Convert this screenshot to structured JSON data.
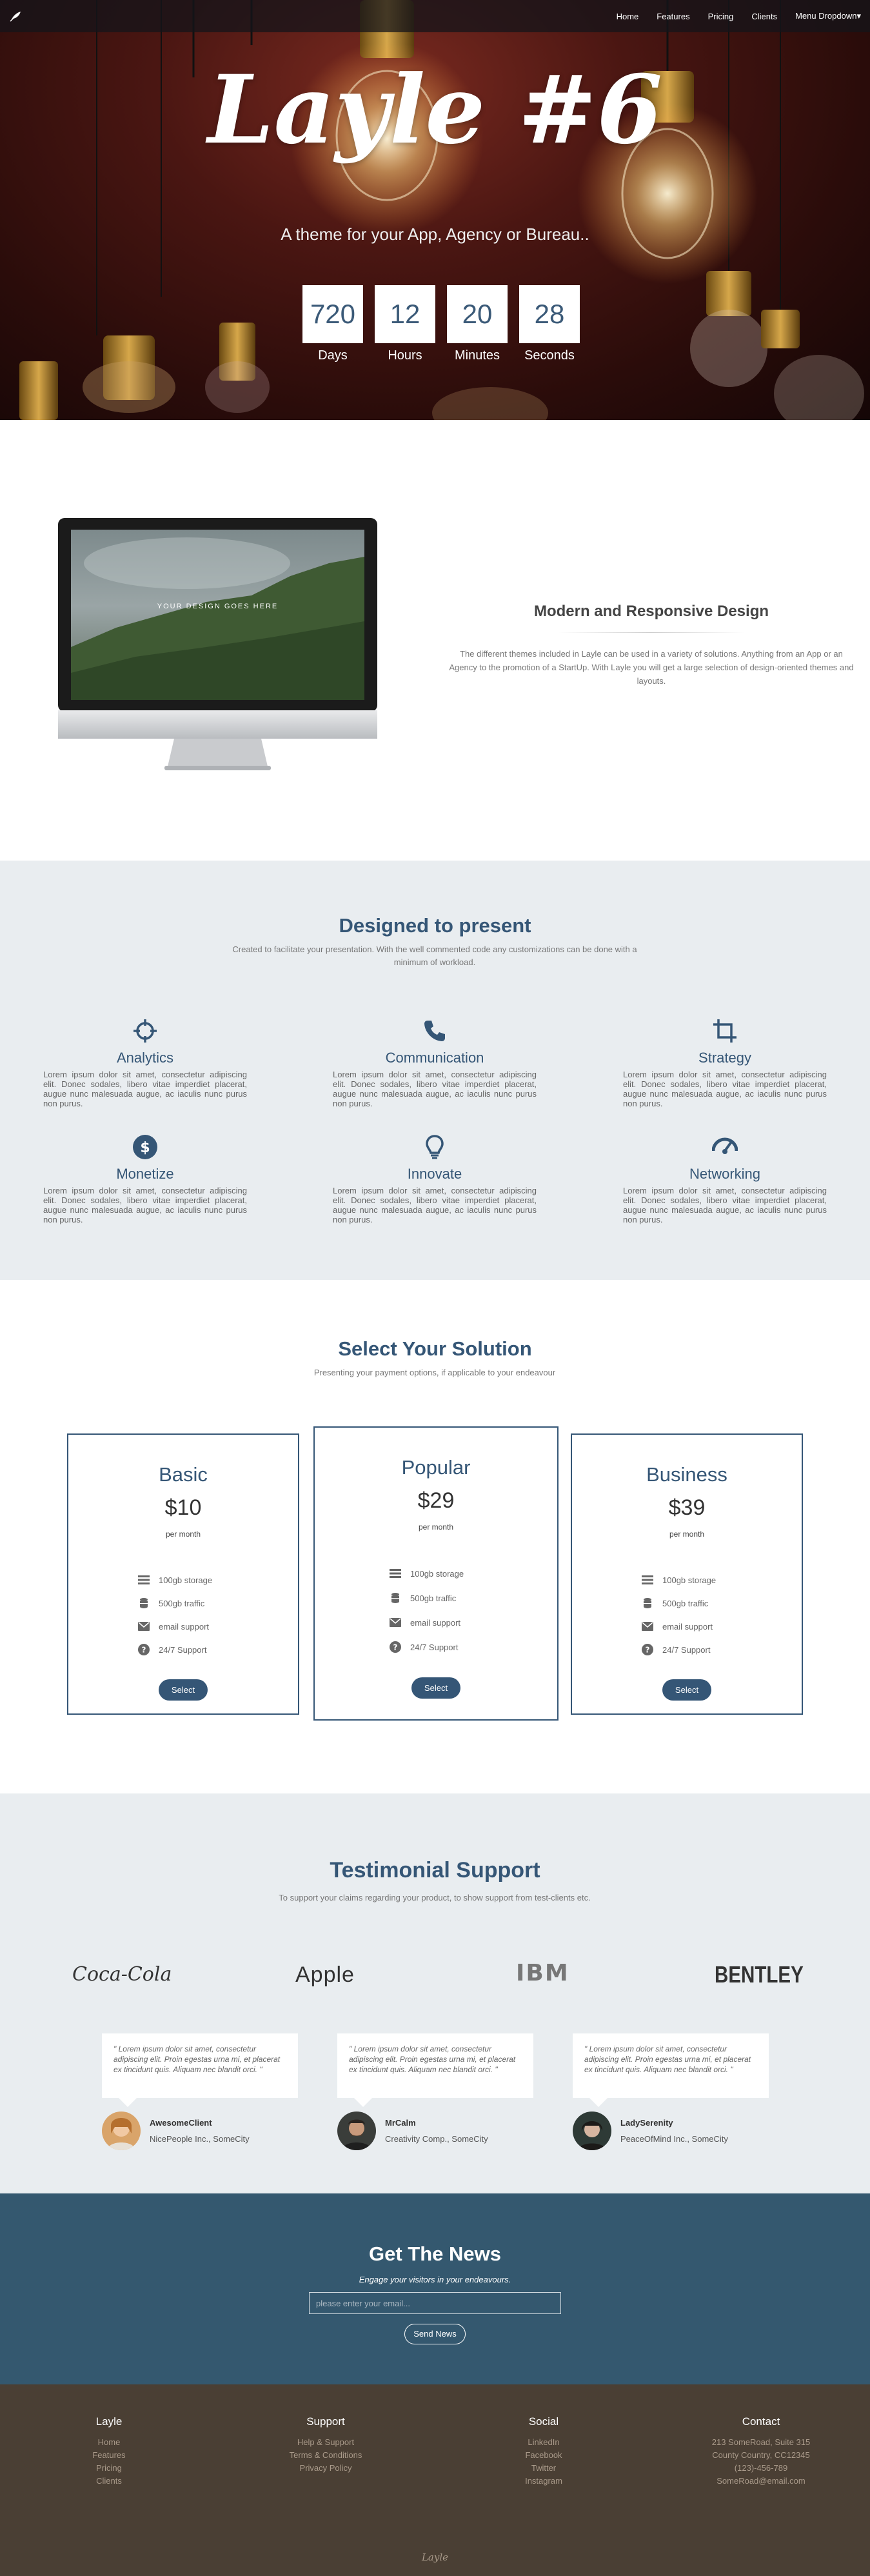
{
  "nav": {
    "items": [
      {
        "label": "Home"
      },
      {
        "label": "Features"
      },
      {
        "label": "Pricing"
      },
      {
        "label": "Clients"
      },
      {
        "label": "Menu Dropdown",
        "caret": "▾"
      }
    ]
  },
  "hero": {
    "title": "Layle #6",
    "subtitle": "A theme for your App, Agency or Bureau..",
    "countdown": [
      {
        "value": "720",
        "label": "Days"
      },
      {
        "value": "12",
        "label": "Hours"
      },
      {
        "value": "20",
        "label": "Minutes"
      },
      {
        "value": "28",
        "label": "Seconds"
      }
    ]
  },
  "responsive": {
    "screen_text": "YOUR DESIGN GOES HERE",
    "title": "Modern and Responsive Design",
    "text": "The different themes included in Layle can be used in a variety of solutions. Anything from an App or an Agency to the promotion of a StartUp. With Layle you will get a large selection of design-oriented themes and layouts."
  },
  "features": {
    "title": "Designed to present",
    "subtitle": "Created to facilitate your presentation. With the well commented code any customizations can be done with a minimum of workload.",
    "items": [
      {
        "icon": "crosshair-icon",
        "title": "Analytics",
        "text": "Lorem ipsum dolor sit amet, consectetur adipiscing elit. Donec sodales, libero vitae imperdiet placerat, augue nunc malesuada augue, ac iaculis nunc purus non purus."
      },
      {
        "icon": "phone-icon",
        "title": "Communication",
        "text": "Lorem ipsum dolor sit amet, consectetur adipiscing elit. Donec sodales, libero vitae imperdiet placerat, augue nunc malesuada augue, ac iaculis nunc purus non purus."
      },
      {
        "icon": "crop-icon",
        "title": "Strategy",
        "text": "Lorem ipsum dolor sit amet, consectetur adipiscing elit. Donec sodales, libero vitae imperdiet placerat, augue nunc malesuada augue, ac iaculis nunc purus non purus."
      },
      {
        "icon": "dollar-icon",
        "title": "Monetize",
        "text": "Lorem ipsum dolor sit amet, consectetur adipiscing elit. Donec sodales, libero vitae imperdiet placerat, augue nunc malesuada augue, ac iaculis nunc purus non purus."
      },
      {
        "icon": "lightbulb-icon",
        "title": "Innovate",
        "text": "Lorem ipsum dolor sit amet, consectetur adipiscing elit. Donec sodales, libero vitae imperdiet placerat, augue nunc malesuada augue, ac iaculis nunc purus non purus."
      },
      {
        "icon": "gauge-icon",
        "title": "Networking",
        "text": "Lorem ipsum dolor sit amet, consectetur adipiscing elit. Donec sodales, libero vitae imperdiet placerat, augue nunc malesuada augue, ac iaculis nunc purus non purus."
      }
    ]
  },
  "pricing": {
    "title": "Select Your Solution",
    "subtitle": "Presenting your payment options, if applicable to your endeavour",
    "plans": [
      {
        "name": "Basic",
        "price": "$10",
        "per": "per month",
        "features": [
          "100gb storage",
          "500gb traffic",
          "email support",
          "24/7 Support"
        ],
        "button": "Select"
      },
      {
        "name": "Popular",
        "price": "$29",
        "per": "per month",
        "features": [
          "100gb storage",
          "500gb traffic",
          "email support",
          "24/7 Support"
        ],
        "button": "Select"
      },
      {
        "name": "Business",
        "price": "$39",
        "per": "per month",
        "features": [
          "100gb storage",
          "500gb traffic",
          "email support",
          "24/7 Support"
        ],
        "button": "Select"
      }
    ]
  },
  "testimonials": {
    "title": "Testimonial Support",
    "subtitle": "To support your claims regarding your product, to show support from test-clients etc.",
    "logos": [
      "Coca-Cola",
      "Apple",
      "IBM",
      "BENTLEY"
    ],
    "items": [
      {
        "quote": "\" Lorem ipsum dolor sit amet, consectetur adipiscing elit. Proin egestas urna mi, et placerat ex tincidunt quis. Aliquam nec blandit orci. \"",
        "name": "AwesomeClient",
        "company": "NicePeople Inc., SomeCity"
      },
      {
        "quote": "\" Lorem ipsum dolor sit amet, consectetur adipiscing elit. Proin egestas urna mi, et placerat ex tincidunt quis. Aliquam nec blandit orci. \"",
        "name": "MrCalm",
        "company": "Creativity Comp., SomeCity"
      },
      {
        "quote": "\" Lorem ipsum dolor sit amet, consectetur adipiscing elit. Proin egestas urna mi, et placerat ex tincidunt quis. Aliquam nec blandit orci. \"",
        "name": "LadySerenity",
        "company": "PeaceOfMind Inc., SomeCity"
      }
    ]
  },
  "newsletter": {
    "title": "Get The News",
    "subtitle": "Engage your visitors in your endeavours.",
    "placeholder": "please enter your email...",
    "button": "Send News"
  },
  "footer": {
    "columns": [
      {
        "heading": "Layle",
        "links": [
          "Home",
          "Features",
          "Pricing",
          "Clients"
        ]
      },
      {
        "heading": "Support",
        "links": [
          "Help & Support",
          "Terms & Conditions",
          "Privacy Policy"
        ]
      },
      {
        "heading": "Social",
        "links": [
          "LinkedIn",
          "Facebook",
          "Twitter",
          "Instagram"
        ]
      },
      {
        "heading": "Contact",
        "links": [
          "213 SomeRoad, Suite 315",
          "County Country, CC12345",
          "(123)-456-789",
          "SomeRoad@email.com"
        ]
      }
    ],
    "brand": "Layle"
  },
  "colors": {
    "accent": "#355676",
    "section_gray": "#e9edf0",
    "newsletter_bg": "#34586f",
    "footer_bg": "#4a3f34"
  }
}
